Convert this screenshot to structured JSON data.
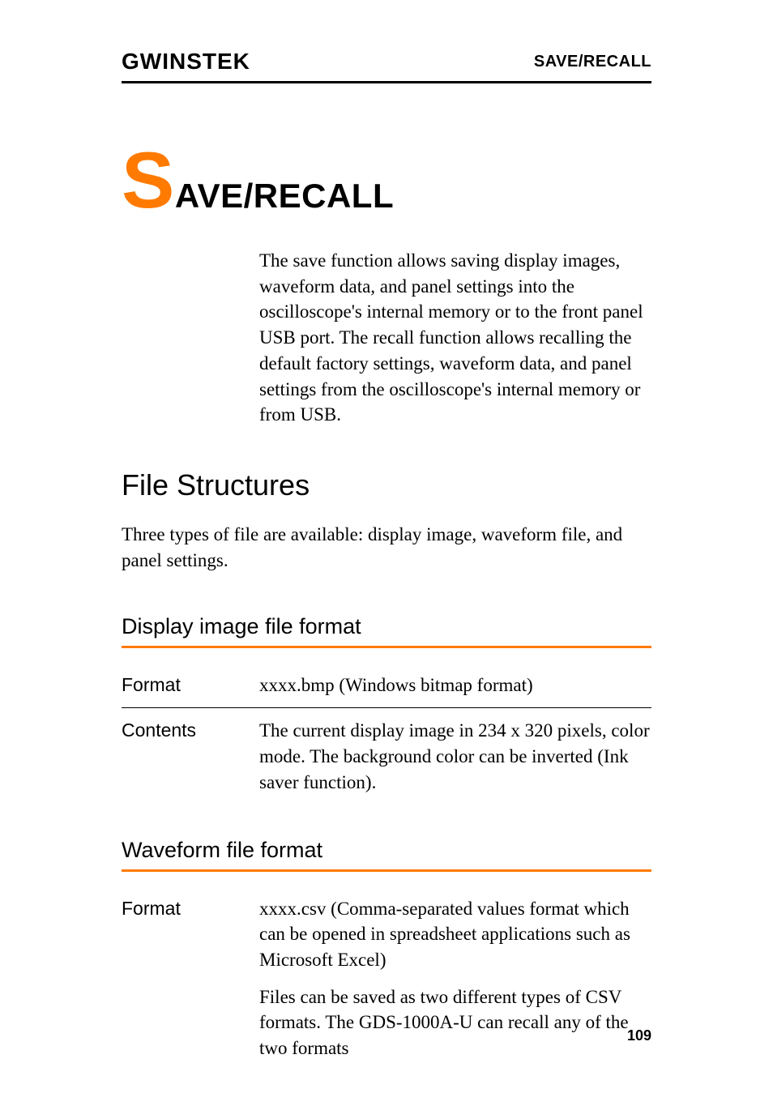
{
  "header": {
    "brand": "GWINSTEK",
    "section": "SAVE/RECALL"
  },
  "chapter": {
    "big_letter": "S",
    "rest": "AVE/RECALL",
    "intro": "The save function allows saving display images, waveform data, and panel settings into the oscilloscope's internal memory or to the front panel USB port. The recall function allows recalling the default factory settings, waveform data, and panel settings from the oscilloscope's internal memory or from USB."
  },
  "sections": {
    "file_structures": {
      "heading": "File Structures",
      "body": "Three types of file are available: display image, waveform file, and panel settings."
    },
    "display_image": {
      "heading": "Display image file format",
      "rows": {
        "format_label": "Format",
        "format_value": "xxxx.bmp (Windows bitmap format)",
        "contents_label": "Contents",
        "contents_value": "The current display image in 234 x 320 pixels, color mode. The background color can be inverted (Ink saver function)."
      }
    },
    "waveform": {
      "heading": "Waveform file format",
      "rows": {
        "format_label": "Format",
        "format_value_1": "xxxx.csv (Comma-separated values format which can be opened in spreadsheet applications such as Microsoft Excel)",
        "format_value_2": "Files can be saved as two different types of CSV formats. The GDS-1000A-U can recall any of the two formats"
      }
    }
  },
  "page_number": "109"
}
